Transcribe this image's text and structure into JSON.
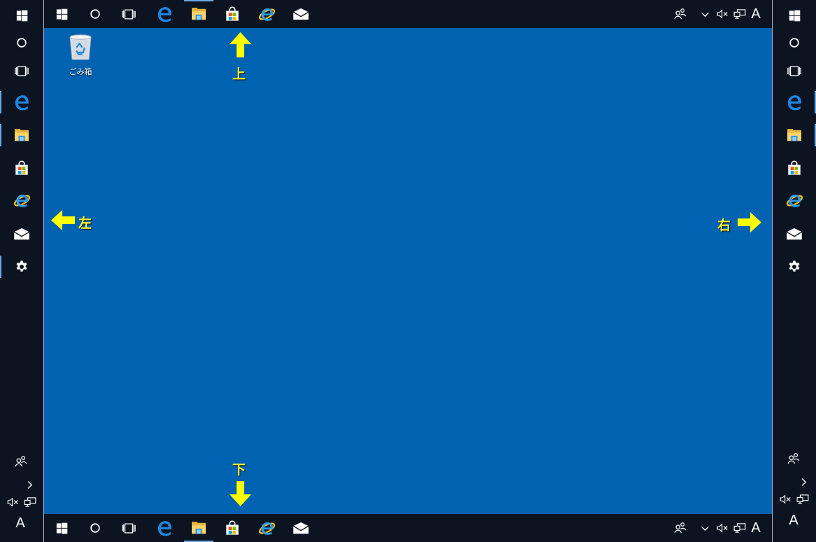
{
  "desktop": {
    "recycle_bin_label": "ごみ箱",
    "background_color": "#0063b1",
    "taskbar_color": "#0c1422",
    "accent_color": "#6aa8e6"
  },
  "taskbar": {
    "pinned_apps": [
      "start-icon",
      "cortana-icon",
      "task-view-icon",
      "edge-icon",
      "file-explorer-icon",
      "store-icon",
      "internet-explorer-icon",
      "mail-icon"
    ],
    "vertical_extra_app": "settings-icon",
    "tray_icons": [
      "people-icon",
      "chevron-up-icon",
      "volume-muted-icon",
      "network-icon"
    ],
    "ime_indicator": "A"
  },
  "annotations": {
    "top": "上",
    "bottom": "下",
    "left": "左",
    "right": "右",
    "arrow_color": "#ffff00"
  }
}
